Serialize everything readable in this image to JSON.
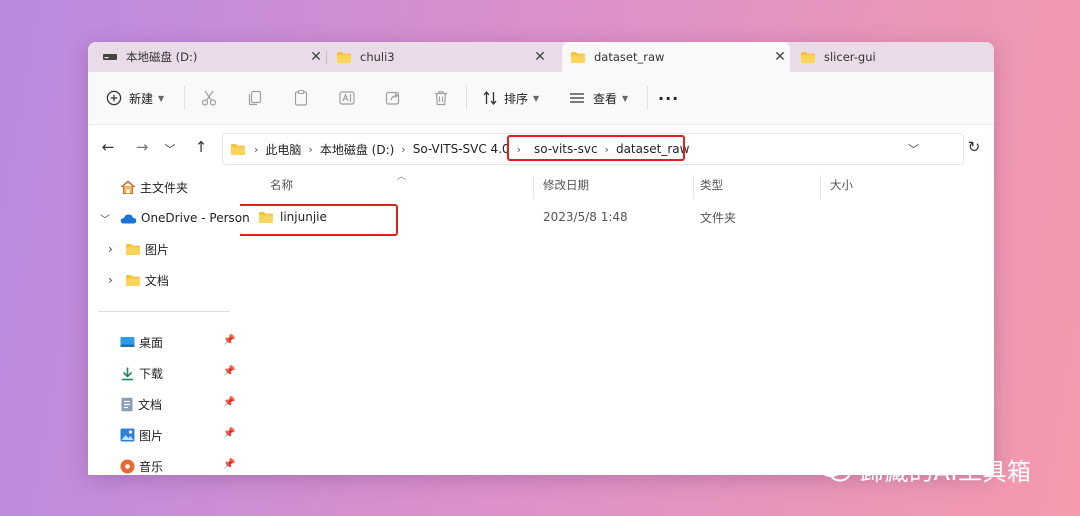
{
  "tabs": [
    {
      "label": "本地磁盘 (D:)",
      "icon": "drive-icon",
      "active": false
    },
    {
      "label": "chuli3",
      "icon": "folder-icon",
      "active": false
    },
    {
      "label": "dataset_raw",
      "icon": "folder-icon",
      "active": true
    },
    {
      "label": "slicer-gui",
      "icon": "folder-icon",
      "active": false
    }
  ],
  "toolbar": {
    "new_label": "新建",
    "sort_label": "排序",
    "view_label": "查看",
    "more_label": "···",
    "icons": [
      "cut-icon",
      "copy-icon",
      "paste-icon",
      "rename-icon",
      "share-icon",
      "delete-icon"
    ]
  },
  "address": {
    "crumbs": [
      "此电脑",
      "本地磁盘 (D:)",
      "So-VITS-SVC 4.0",
      "so-vits-svc",
      "dataset_raw"
    ]
  },
  "sidebar": {
    "home": "主文件夹",
    "onedrive": "OneDrive - Person",
    "onedrive_children": [
      "图片",
      "文档"
    ],
    "quick": [
      "桌面",
      "下载",
      "文档",
      "图片",
      "音乐"
    ]
  },
  "columns": {
    "name": "名称",
    "modified": "修改日期",
    "type": "类型",
    "size": "大小"
  },
  "rows": [
    {
      "name": "linjunjie",
      "modified": "2023/5/8 1:48",
      "type": "文件夹",
      "size": ""
    }
  ],
  "watermark": "歸藏的AI工具箱",
  "colors": {
    "folder": "#f5c33b",
    "highlight_box": "#e0201c",
    "onedrive": "#1a73d9"
  }
}
